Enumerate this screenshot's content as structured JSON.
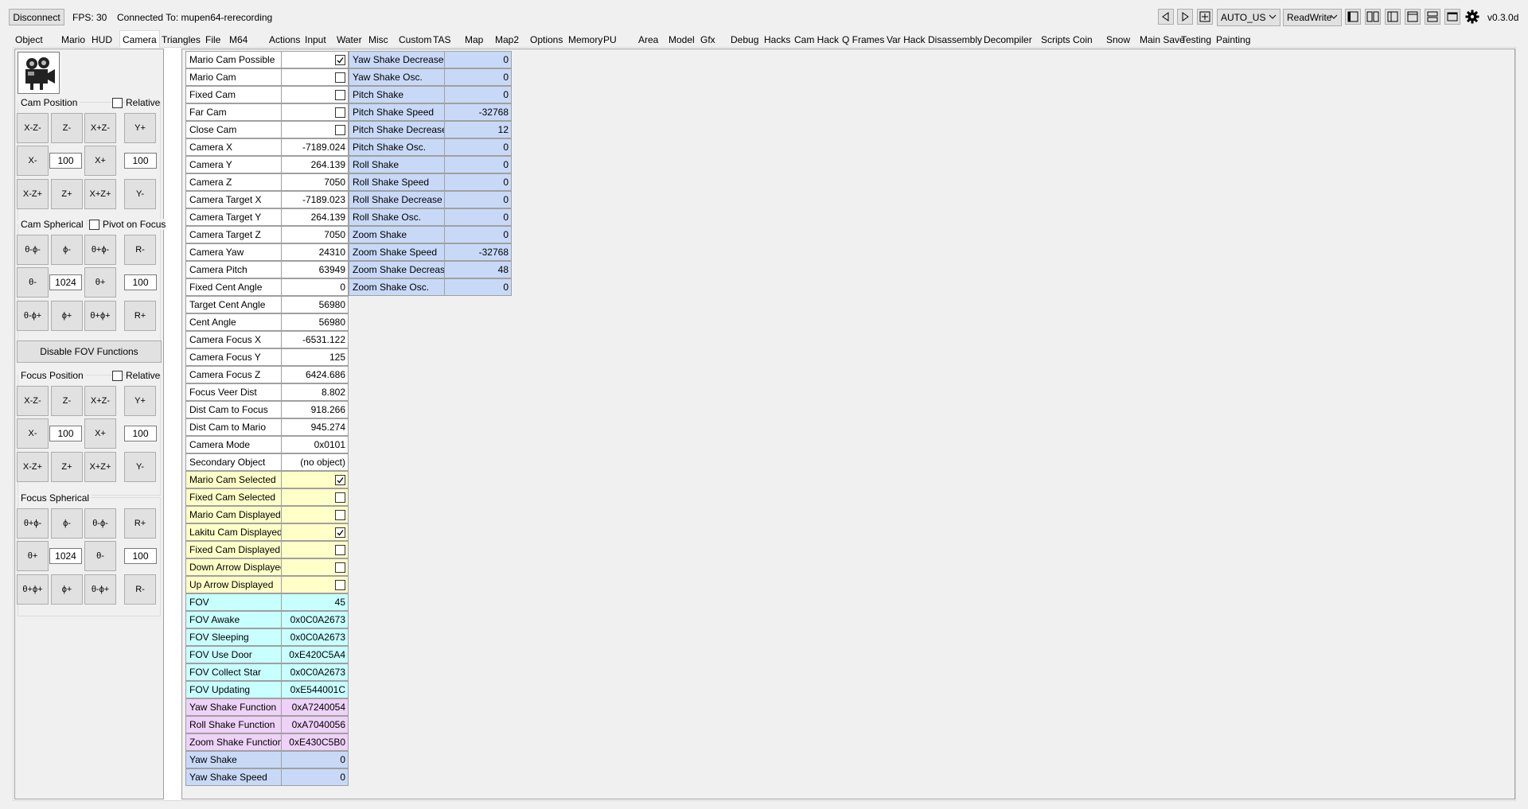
{
  "topbar": {
    "disconnect": "Disconnect",
    "fps": "FPS: 30",
    "connected": "Connected To: mupen64-rerecording",
    "region": "AUTO_US",
    "mode": "ReadWrite",
    "version": "v0.3.0d"
  },
  "tabs": [
    "Object",
    "Mario",
    "HUD",
    "Camera",
    "Triangles",
    "File",
    "M64",
    "Actions",
    "Input",
    "Water",
    "Misc",
    "Custom",
    "TAS",
    "Map",
    "Map2",
    "Options",
    "Memory",
    "PU",
    "Area",
    "Model",
    "Gfx",
    "Debug",
    "Hacks",
    "Cam Hack",
    "Q Frames",
    "Var Hack",
    "Disassembly",
    "Decompiler",
    "Scripts",
    "Coin",
    "Snow",
    "Main Save",
    "Testing",
    "Painting"
  ],
  "selected_tab": "Camera",
  "left": {
    "cam_position": "Cam Position",
    "relative": "Relative",
    "cam_pos_btns": [
      "X-Z-",
      "Z-",
      "X+Z-",
      "Y+",
      "X-",
      "X+",
      "X-Z+",
      "Z+",
      "X+Z+",
      "Y-"
    ],
    "cam_pos_val1": "100",
    "cam_pos_val2": "100",
    "cam_spherical": "Cam Spherical",
    "pivot": "Pivot on Focus",
    "cam_sph_btns": [
      "θ-ϕ-",
      "ϕ-",
      "θ+ϕ-",
      "R-",
      "θ-",
      "θ+",
      "θ-ϕ+",
      "ϕ+",
      "θ+ϕ+",
      "R+"
    ],
    "cam_sph_val1": "1024",
    "cam_sph_val2": "100",
    "disable_fov": "Disable FOV Functions",
    "focus_position": "Focus Position",
    "focus_relative": "Relative",
    "focus_pos_btns": [
      "X-Z-",
      "Z-",
      "X+Z-",
      "Y+",
      "X-",
      "X+",
      "X-Z+",
      "Z+",
      "X+Z+",
      "Y-"
    ],
    "focus_pos_val1": "100",
    "focus_pos_val2": "100",
    "focus_spherical": "Focus Spherical",
    "focus_sph_btns": [
      "θ+ϕ-",
      "ϕ-",
      "θ-ϕ-",
      "R+",
      "θ+",
      "θ-",
      "θ+ϕ+",
      "ϕ+",
      "θ-ϕ+",
      "R-"
    ],
    "focus_sph_val1": "1024",
    "focus_sph_val2": "100"
  },
  "col1": [
    {
      "name": "Mario Cam Possible",
      "value": "",
      "check": true,
      "color": "#ffffff"
    },
    {
      "name": "Mario Cam",
      "value": "",
      "check": false,
      "color": "#ffffff"
    },
    {
      "name": "Fixed Cam",
      "value": "",
      "check": false,
      "color": "#ffffff"
    },
    {
      "name": "Far Cam",
      "value": "",
      "check": false,
      "color": "#ffffff"
    },
    {
      "name": "Close Cam",
      "value": "",
      "check": false,
      "color": "#ffffff"
    },
    {
      "name": "Camera X",
      "value": "-7189.024",
      "color": "#ffffff"
    },
    {
      "name": "Camera Y",
      "value": "264.139",
      "color": "#ffffff"
    },
    {
      "name": "Camera Z",
      "value": "7050",
      "color": "#ffffff"
    },
    {
      "name": "Camera Target X",
      "value": "-7189.023",
      "color": "#ffffff"
    },
    {
      "name": "Camera Target Y",
      "value": "264.139",
      "color": "#ffffff"
    },
    {
      "name": "Camera Target Z",
      "value": "7050",
      "color": "#ffffff"
    },
    {
      "name": "Camera Yaw",
      "value": "24310",
      "color": "#ffffff"
    },
    {
      "name": "Camera Pitch",
      "value": "63949",
      "color": "#ffffff"
    },
    {
      "name": "Fixed Cent Angle",
      "value": "0",
      "color": "#ffffff"
    },
    {
      "name": "Target Cent Angle",
      "value": "56980",
      "color": "#ffffff"
    },
    {
      "name": "Cent Angle",
      "value": "56980",
      "color": "#ffffff"
    },
    {
      "name": "Camera Focus X",
      "value": "-6531.122",
      "color": "#ffffff"
    },
    {
      "name": "Camera Focus Y",
      "value": "125",
      "color": "#ffffff"
    },
    {
      "name": "Camera Focus Z",
      "value": "6424.686",
      "color": "#ffffff"
    },
    {
      "name": "Focus Veer Dist",
      "value": "8.802",
      "color": "#ffffff"
    },
    {
      "name": "Dist Cam to Focus",
      "value": "918.266",
      "color": "#ffffff"
    },
    {
      "name": "Dist Cam to Mario",
      "value": "945.274",
      "color": "#ffffff"
    },
    {
      "name": "Camera Mode",
      "value": "0x0101",
      "color": "#ffffff"
    },
    {
      "name": "Secondary Object",
      "value": "(no object)",
      "color": "#ffffff"
    },
    {
      "name": "Mario Cam Selected",
      "value": "",
      "check": true,
      "color": "#ffffc8"
    },
    {
      "name": "Fixed Cam Selected",
      "value": "",
      "check": false,
      "color": "#ffffc8"
    },
    {
      "name": "Mario Cam Displayed",
      "value": "",
      "check": false,
      "color": "#ffffc8"
    },
    {
      "name": "Lakitu Cam Displayed",
      "value": "",
      "check": true,
      "color": "#ffffc8"
    },
    {
      "name": "Fixed Cam Displayed",
      "value": "",
      "check": false,
      "color": "#ffffc8"
    },
    {
      "name": "Down Arrow Displayed",
      "value": "",
      "check": false,
      "color": "#ffffc8"
    },
    {
      "name": "Up Arrow Displayed",
      "value": "",
      "check": false,
      "color": "#ffffc8"
    },
    {
      "name": "FOV",
      "value": "45",
      "color": "#c8ffff"
    },
    {
      "name": "FOV Awake",
      "value": "0x0C0A2673",
      "color": "#c8ffff"
    },
    {
      "name": "FOV Sleeping",
      "value": "0x0C0A2673",
      "color": "#c8ffff"
    },
    {
      "name": "FOV Use Door",
      "value": "0xE420C5A4",
      "color": "#c8ffff"
    },
    {
      "name": "FOV Collect Star",
      "value": "0x0C0A2673",
      "color": "#c8ffff"
    },
    {
      "name": "FOV Updating",
      "value": "0xE544001C",
      "color": "#c8ffff"
    },
    {
      "name": "Yaw Shake Function",
      "value": "0xA7240054",
      "color": "#eed2f8"
    },
    {
      "name": "Roll Shake Function",
      "value": "0xA7040056",
      "color": "#eed2f8"
    },
    {
      "name": "Zoom Shake Function",
      "value": "0xE430C5B0",
      "color": "#eed2f8"
    },
    {
      "name": "Yaw Shake",
      "value": "0",
      "color": "#c8d9f8"
    },
    {
      "name": "Yaw Shake Speed",
      "value": "0",
      "color": "#c8d9f8"
    }
  ],
  "col2": [
    {
      "name": "Yaw Shake Decrease",
      "value": "0"
    },
    {
      "name": "Yaw Shake Osc.",
      "value": "0"
    },
    {
      "name": "Pitch Shake",
      "value": "0"
    },
    {
      "name": "Pitch Shake Speed",
      "value": "-32768"
    },
    {
      "name": "Pitch Shake Decrease",
      "value": "12"
    },
    {
      "name": "Pitch Shake Osc.",
      "value": "0"
    },
    {
      "name": "Roll Shake",
      "value": "0"
    },
    {
      "name": "Roll Shake Speed",
      "value": "0"
    },
    {
      "name": "Roll Shake Decrease",
      "value": "0"
    },
    {
      "name": "Roll Shake Osc.",
      "value": "0"
    },
    {
      "name": "Zoom Shake",
      "value": "0"
    },
    {
      "name": "Zoom Shake Speed",
      "value": "-32768"
    },
    {
      "name": "Zoom Shake Decrease",
      "value": "48"
    },
    {
      "name": "Zoom Shake Osc.",
      "value": "0"
    }
  ],
  "col2_color": "#c8d9f8"
}
